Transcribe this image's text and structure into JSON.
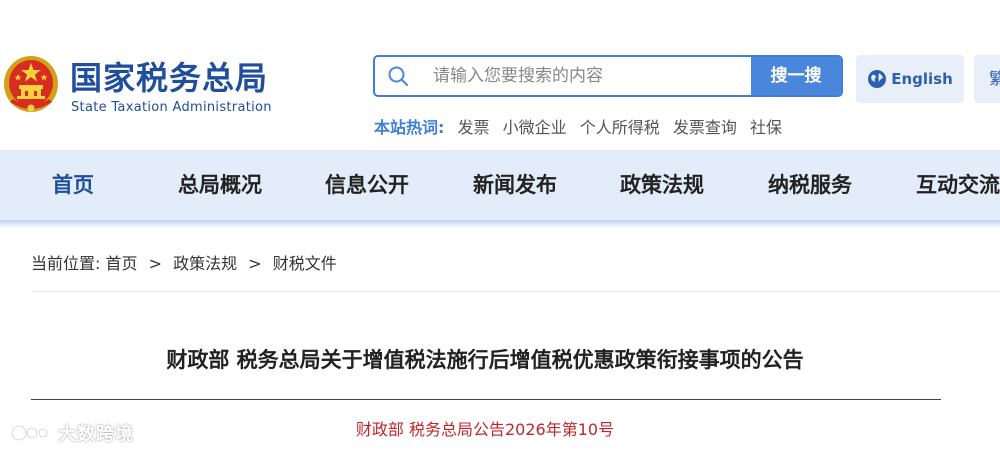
{
  "header": {
    "site_name_cn": "国家税务总局",
    "site_name_en": "State Taxation Administration",
    "search": {
      "placeholder": "请输入您要搜索的内容",
      "button_label": "搜一搜"
    },
    "lang_english": "English",
    "lang_traditional": "繁",
    "hot_words": {
      "label": "本站热词:",
      "items": [
        "发票",
        "小微企业",
        "个人所得税",
        "发票查询",
        "社保"
      ]
    }
  },
  "nav": {
    "items": [
      "首页",
      "总局概况",
      "信息公开",
      "新闻发布",
      "政策法规",
      "纳税服务",
      "互动交流"
    ],
    "active_index": 0
  },
  "breadcrumb": {
    "prefix": "当前位置:",
    "items": [
      "首页",
      "政策法规",
      "财税文件"
    ],
    "separator": ">"
  },
  "article": {
    "title": "财政部 税务总局关于增值税法施行后增值税优惠政策衔接事项的公告",
    "doc_number": "财政部 税务总局公告2026年第10号"
  },
  "watermark": {
    "text": "大数跨境"
  },
  "colors": {
    "brand_blue": "#1f4e9c",
    "accent_blue": "#4a86db",
    "nav_bg": "#e3edf9",
    "doc_number_red": "#c0262b"
  }
}
